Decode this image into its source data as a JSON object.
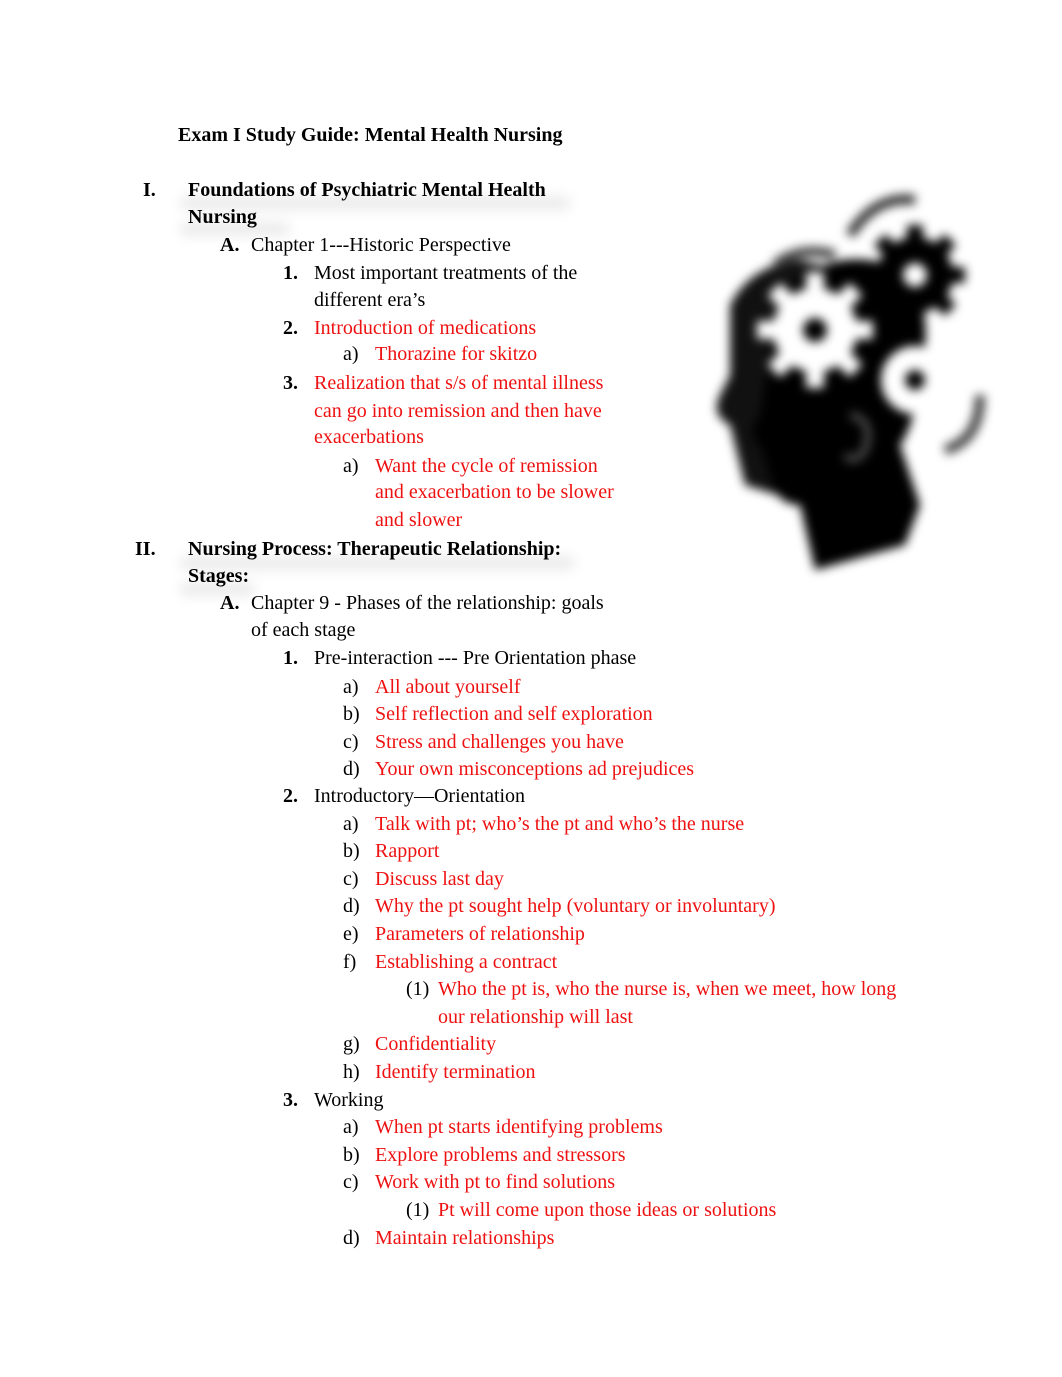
{
  "document": {
    "title": "Exam I Study Guide: Mental Health Nursing",
    "sections": [
      {
        "marker": "I.",
        "heading_lines": [
          "Foundations of  Psychiatric Mental Health",
          "Nursing"
        ],
        "subsections": [
          {
            "marker": "A.",
            "lines": [
              "Chapter 1---Historic Perspective"
            ],
            "items": [
              {
                "marker": "1.",
                "lines": [
                  "Most important treatments of the",
                  "different era’s"
                ],
                "color": "black"
              },
              {
                "marker": "2.",
                "lines": [
                  "Introduction of medications"
                ],
                "color": "red",
                "sub": [
                  {
                    "marker": "a)",
                    "lines": [
                      "Thorazine for skitzo"
                    ]
                  }
                ]
              },
              {
                "marker": "3.",
                "lines": [
                  "Realization that s/s of mental illness",
                  "can go into remission and then have",
                  "exacerbations"
                ],
                "color": "red",
                "sub": [
                  {
                    "marker": "a)",
                    "lines": [
                      "Want the cycle of remission",
                      "and exacerbation to be slower",
                      "and slower"
                    ]
                  }
                ]
              }
            ]
          }
        ]
      },
      {
        "marker": "II.",
        "heading_lines": [
          "Nursing Process: Therapeutic Relationship:",
          "Stages:"
        ],
        "subsections": [
          {
            "marker": "A.",
            "lines": [
              "Chapter  9 - Phases of the relationship: goals",
              "of each stage"
            ],
            "items": [
              {
                "marker": "1.",
                "lines": [
                  "Pre-interaction --- Pre Orientation phase"
                ],
                "color": "black",
                "sub": [
                  {
                    "marker": "a)",
                    "lines": [
                      "All about yourself"
                    ]
                  },
                  {
                    "marker": "b)",
                    "lines": [
                      "Self reflection and self exploration"
                    ]
                  },
                  {
                    "marker": "c)",
                    "lines": [
                      "Stress and challenges you have"
                    ]
                  },
                  {
                    "marker": "d)",
                    "lines": [
                      "Your own misconceptions ad prejudices"
                    ]
                  }
                ]
              },
              {
                "marker": "2.",
                "lines": [
                  "Introductory—Orientation"
                ],
                "color": "black",
                "sub": [
                  {
                    "marker": "a)",
                    "lines": [
                      "Talk with pt; who’s the pt and who’s the nurse"
                    ]
                  },
                  {
                    "marker": "b)",
                    "lines": [
                      "Rapport"
                    ]
                  },
                  {
                    "marker": "c)",
                    "lines": [
                      "Discuss last day"
                    ]
                  },
                  {
                    "marker": "d)",
                    "lines": [
                      "Why the pt sought help (voluntary or involuntary)"
                    ]
                  },
                  {
                    "marker": "e)",
                    "lines": [
                      "Parameters of relationship"
                    ]
                  },
                  {
                    "marker": "f)",
                    "lines": [
                      "Establishing a contract"
                    ],
                    "sub": [
                      {
                        "marker": "(1)",
                        "lines": [
                          "Who the pt is, who the nurse is, when we meet, how long",
                          "our relationship will last"
                        ]
                      }
                    ]
                  },
                  {
                    "marker": "g)",
                    "lines": [
                      "Confidentiality"
                    ]
                  },
                  {
                    "marker": "h)",
                    "lines": [
                      "Identify termination"
                    ]
                  }
                ]
              },
              {
                "marker": "3.",
                "lines": [
                  "Working"
                ],
                "color": "black",
                "sub": [
                  {
                    "marker": "a)",
                    "lines": [
                      "When pt starts identifying problems"
                    ]
                  },
                  {
                    "marker": "b)",
                    "lines": [
                      "Explore problems and stressors"
                    ]
                  },
                  {
                    "marker": "c)",
                    "lines": [
                      "Work with pt to find solutions"
                    ],
                    "sub": [
                      {
                        "marker": "(1)",
                        "lines": [
                          "Pt will come upon those ideas or solutions"
                        ]
                      }
                    ]
                  },
                  {
                    "marker": "d)",
                    "lines": [
                      "Maintain relationships"
                    ]
                  }
                ]
              }
            ]
          }
        ]
      }
    ]
  },
  "illustration": {
    "icon": "head-with-gears-icon"
  },
  "colors": {
    "annotation": "#ee1111",
    "text": "#000000"
  }
}
